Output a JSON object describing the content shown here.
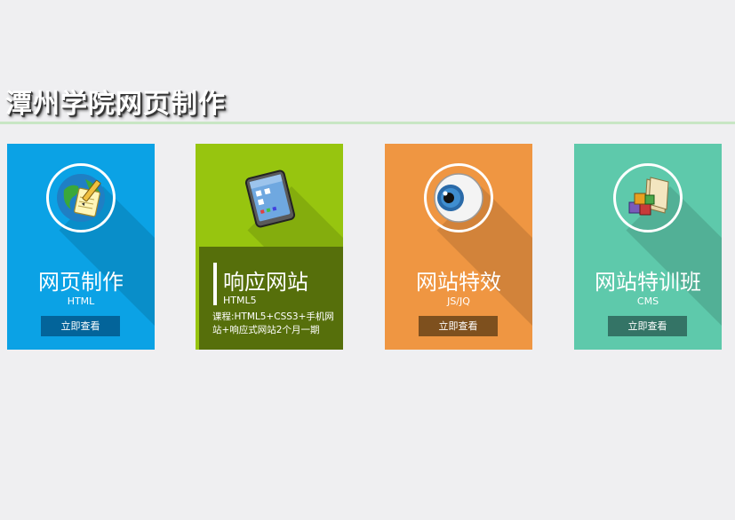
{
  "header": {
    "title": "潭州学院网页制作"
  },
  "cards": [
    {
      "name": "网页制作",
      "sub": "HTML",
      "button": "立即查看",
      "icon": "globe-notepad-icon",
      "bg": "#0ba2e5",
      "btn_bg": "#03649a"
    },
    {
      "name": "响应网站",
      "sub": "HTML5",
      "description": "课程:HTML5+CSS3+手机网站+响应式网站2个月一期",
      "icon": "tablet-icon",
      "bg": "#97c50f",
      "overlay_bg": "#566f0b",
      "state": "hover"
    },
    {
      "name": "网站特效",
      "sub": "JS/JQ",
      "button": "立即查看",
      "icon": "eyeball-icon",
      "bg": "#ef9642",
      "btn_bg": "#7e501e"
    },
    {
      "name": "网站特训班",
      "sub": "CMS",
      "button": "立即查看",
      "icon": "folder-blocks-icon",
      "bg": "#5ec9ab",
      "btn_bg": "#347466"
    }
  ]
}
